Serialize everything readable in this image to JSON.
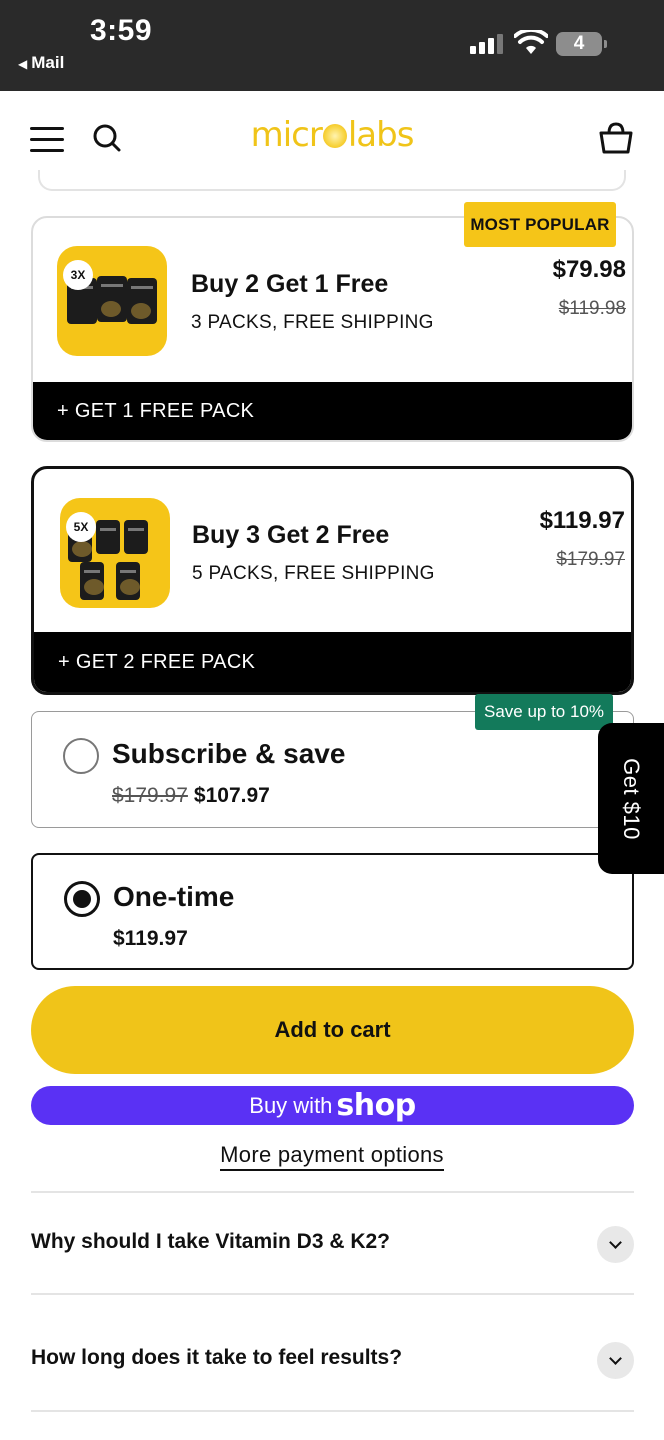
{
  "status_bar": {
    "time": "3:59",
    "back_app": "Mail",
    "battery": "4"
  },
  "header": {
    "logo": {
      "left": "micr",
      "right": "labs"
    }
  },
  "bundles": [
    {
      "badge_qty": "3X",
      "title": "Buy 2 Get 1 Free",
      "subtitle": "3 PACKS, FREE SHIPPING",
      "price": "$79.98",
      "old_price": "$119.98",
      "bar_label": "+ GET 1 FREE PACK",
      "tag": "MOST POPULAR"
    },
    {
      "badge_qty": "5X",
      "title": "Buy 3 Get 2 Free",
      "subtitle": "5 PACKS, FREE SHIPPING",
      "price": "$119.97",
      "old_price": "$179.97",
      "bar_label": "+ GET 2 FREE PACK",
      "selected": true
    }
  ],
  "purchase_options": {
    "subscribe": {
      "title": "Subscribe & save",
      "old_price": "$179.97",
      "price": "$107.97",
      "badge": "Save up to 10%",
      "selected": false
    },
    "one_time": {
      "title": "One-time",
      "price": "$119.97",
      "selected": true
    }
  },
  "promo_tab": "Get $10",
  "buttons": {
    "add_to_cart": "Add to cart",
    "buy_with": "Buy with",
    "shop_word": "shop",
    "more_payment": "More payment options"
  },
  "faq": [
    {
      "question": "Why should I take Vitamin D3 & K2?"
    },
    {
      "question": "How long does it take to feel results?"
    }
  ],
  "colors": {
    "brand_yellow": "#f0c419",
    "shop_purple": "#5a31f4",
    "save_green": "#137a5b"
  }
}
